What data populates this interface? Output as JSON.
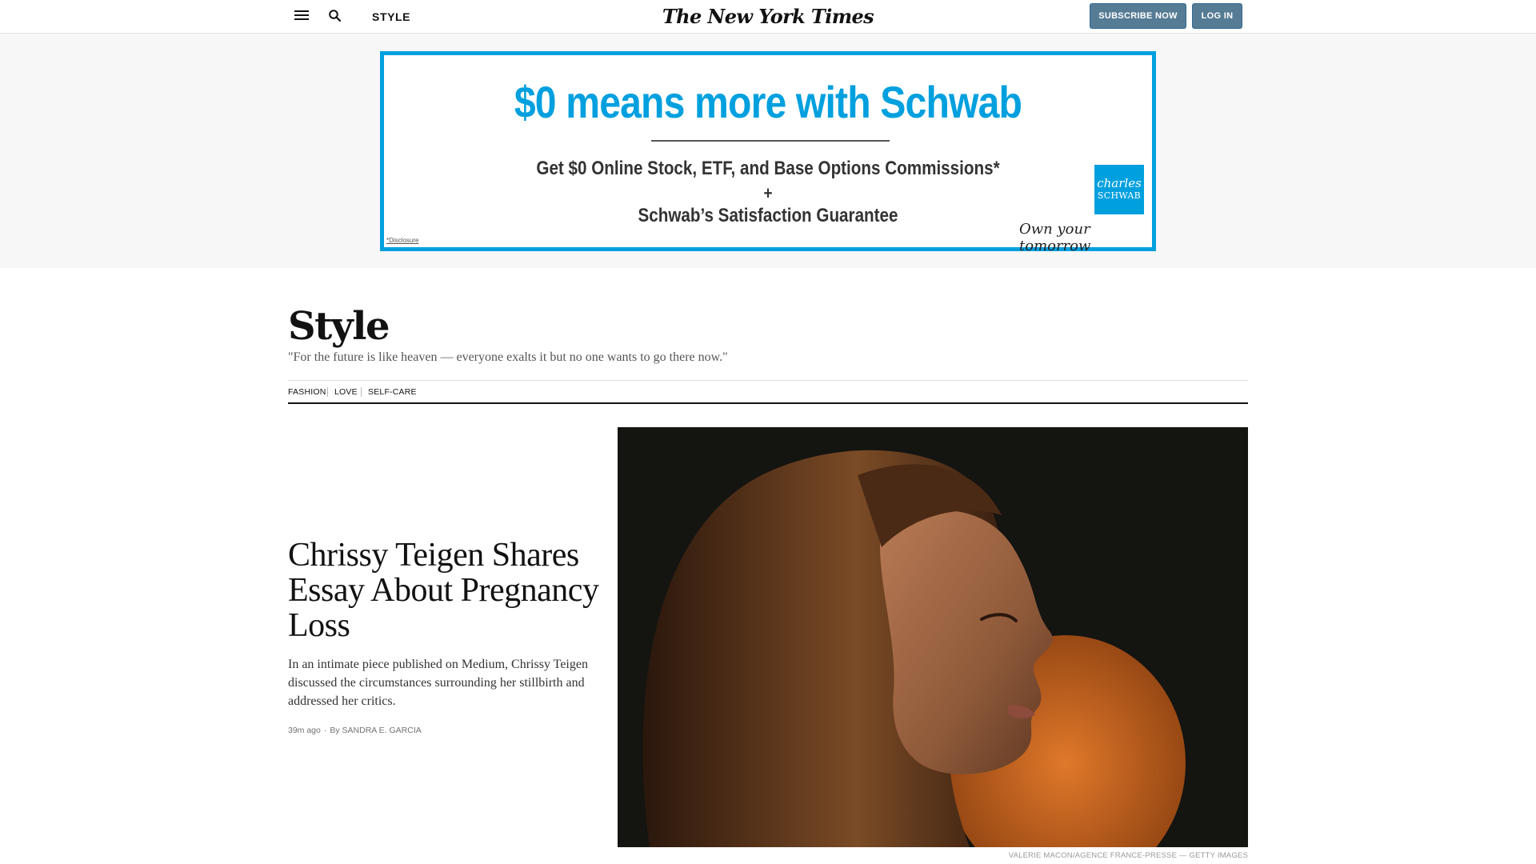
{
  "header": {
    "section_label": "STYLE",
    "logo_text": "The New York Times",
    "subscribe_label": "SUBSCRIBE NOW",
    "login_label": "LOG IN",
    "button_color": "#567b95"
  },
  "ad": {
    "headline": "$0 means more with Schwab",
    "line1": "Get $0 Online Stock, ETF, and Base Options Commissions*",
    "plus": "+",
    "line2": "Schwab’s Satisfaction Guarantee",
    "logo_line1": "charles",
    "logo_line2": "SCHWAB",
    "tagline": "Own your tomorrow",
    "disclosure": "*Disclosure",
    "accent_color": "#00a0df"
  },
  "section": {
    "title": "Style",
    "quote": "\"For the future is like heaven — everyone exalts it but no one wants to go there now.\"",
    "subnav": [
      "FASHION",
      "LOVE",
      "SELF-CARE"
    ]
  },
  "lead_story": {
    "headline": "Chrissy Teigen Shares Essay About Pregnancy Loss",
    "summary": "In an intimate piece published on Medium, Chrissy Teigen discussed the circumstances surrounding her stillbirth and addressed her critics.",
    "time": "39m ago",
    "byline": "By SANDRA E. GARCIA",
    "image_credit": "Valerie Macon/Agence France-Presse — Getty Images"
  }
}
